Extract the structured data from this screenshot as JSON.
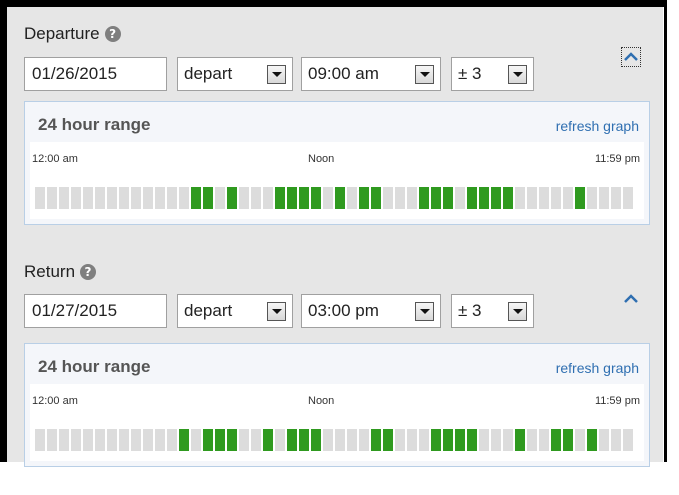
{
  "departure": {
    "label": "Departure",
    "help_icon": "question-circle-icon",
    "date": "01/26/2015",
    "mode": "depart",
    "time": "09:00 am",
    "flex": "± 3",
    "range_title": "24 hour range",
    "refresh_label": "refresh graph",
    "tick_start": "12:00 am",
    "tick_mid": "Noon",
    "tick_end": "11:59 pm",
    "bars": [
      0,
      0,
      0,
      0,
      0,
      0,
      0,
      0,
      0,
      0,
      0,
      0,
      0,
      1,
      1,
      0,
      1,
      0,
      0,
      0,
      1,
      1,
      1,
      1,
      0,
      1,
      0,
      1,
      1,
      0,
      0,
      0,
      1,
      1,
      1,
      0,
      1,
      1,
      1,
      1,
      0,
      0,
      0,
      0,
      0,
      1,
      0,
      0,
      0,
      0
    ]
  },
  "return": {
    "label": "Return",
    "help_icon": "question-circle-icon",
    "date": "01/27/2015",
    "mode": "depart",
    "time": "03:00 pm",
    "flex": "± 3",
    "range_title": "24 hour range",
    "refresh_label": "refresh graph",
    "tick_start": "12:00 am",
    "tick_mid": "Noon",
    "tick_end": "11:59 pm",
    "bars": [
      0,
      0,
      0,
      0,
      0,
      0,
      0,
      0,
      0,
      0,
      0,
      0,
      1,
      0,
      1,
      1,
      1,
      0,
      0,
      1,
      0,
      1,
      1,
      1,
      0,
      0,
      0,
      0,
      1,
      1,
      0,
      0,
      0,
      1,
      1,
      1,
      1,
      0,
      0,
      0,
      1,
      0,
      0,
      1,
      1,
      0,
      1,
      0,
      0,
      0
    ]
  },
  "colors": {
    "bar_on": "#2f9a1f",
    "bar_off": "#dcdcdc",
    "link": "#2f6fb1",
    "range_border": "#b9cfe6"
  },
  "collapse_icon": "chevron-up-icon"
}
